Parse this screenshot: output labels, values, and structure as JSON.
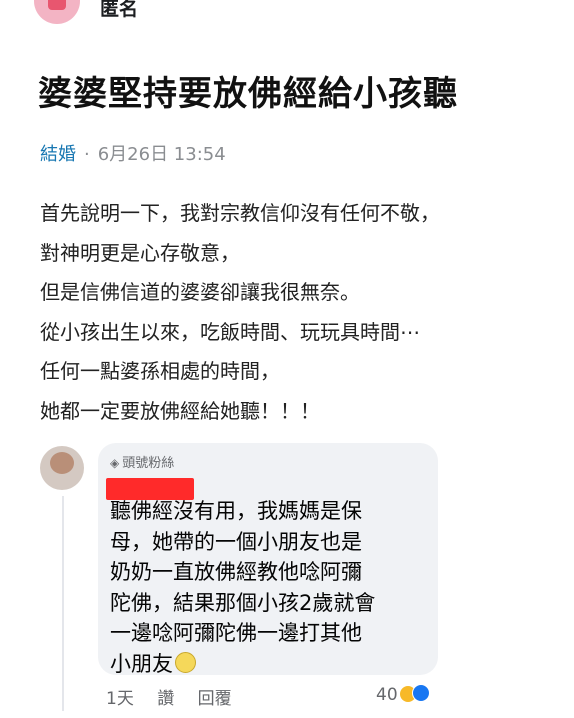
{
  "post": {
    "author": "匿名",
    "title": "婆婆堅持要放佛經給小孩聽",
    "category": "結婚",
    "separator": "·",
    "timestamp": "6月26日 13:54",
    "body_lines": [
      "首先說明一下，我對宗教信仰沒有任何不敬，",
      "對神明更是心存敬意，",
      "但是信佛信道的婆婆卻讓我很無奈。",
      "從小孩出生以來，吃飯時間、玩玩具時間⋯",
      "任何一點婆孫相處的時間，",
      "她都一定要放佛經給她聽！！！"
    ]
  },
  "comment": {
    "badge_icon": "diamond-icon",
    "badge": "頭號粉絲",
    "lines": [
      "聽佛經沒有用，我媽媽是保",
      "母，她帶的一個小朋友也是",
      "奶奶一直放佛經教他唸阿彌",
      "陀佛，結果那個小孩2歲就會",
      "一邊唸阿彌陀佛一邊打其他",
      "小朋友"
    ],
    "time": "1天",
    "like_label": "讚",
    "reply_label": "回覆",
    "reaction_count": "40",
    "reaction_icons": [
      "haha-icon",
      "like-icon"
    ]
  },
  "colors": {
    "category": "#1877b2",
    "meta": "#8a8d91",
    "bubble": "#f0f2f5",
    "redaction": "#ff2a2a"
  }
}
